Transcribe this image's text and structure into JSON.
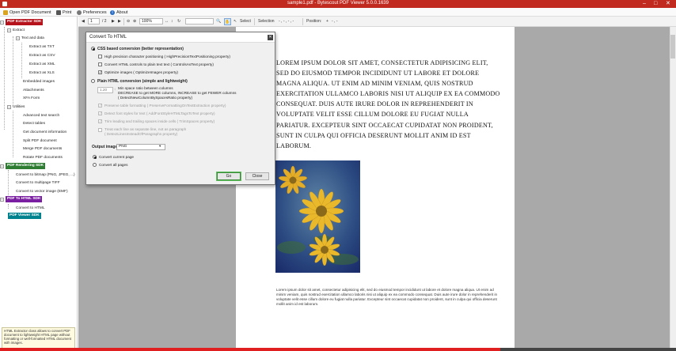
{
  "window": {
    "title": "sample1.pdf - Bytescout PDF Viewer 5.0.0.1639"
  },
  "menu": {
    "open_pdf": "Open PDF Document",
    "print": "Print",
    "preferences": "Preferences",
    "about": "About"
  },
  "tree": {
    "pdf_extractor_sdk": "PDF Extractor SDK",
    "extract": "Extract",
    "text_and_data": "Text and data",
    "extract_txt": "Extract as TXT",
    "extract_csv": "Extract as CSV",
    "extract_xml": "Extract as XML",
    "extract_xls": "Extract as XLS",
    "embedded_images": "Embedded images",
    "attachments": "Attachments",
    "xfa_form": "XFA Form",
    "utilities": "Utilities",
    "advanced_text_search": "Advanced text search",
    "detect_tables": "Detect tables",
    "get_document_information": "Get document information",
    "split_pdf": "Split PDF document",
    "merge_pdf": "Merge PDF documents",
    "rotate_pdf": "Rotate PDF documents",
    "pdf_rendering_sdk": "PDF Rendering SDK",
    "convert_bitmap": "Convert to bitmap (PNG, JPEG, ...)",
    "convert_tiff": "Convert to multipage TIFF",
    "convert_vector": "Convert to vector image (EMF)",
    "pdf_to_html_sdk": "PDF To HTML SDK",
    "convert_html": "Convert to HTML",
    "pdf_viewer_sdk": "PDF Viewer SDK"
  },
  "info_text": "HTML Extractor class allows to convert PDF document to lightweight HTML page without formatting or well-formatted HTML document with images.",
  "toolbar": {
    "page_current": "1",
    "page_total": "/ 2",
    "zoom": "100%",
    "select": "Select",
    "selection": "Selection",
    "selection_value": "- , - , - , -",
    "position": "Position:",
    "position_value": "- , -"
  },
  "document": {
    "heading_text": "Lorem ipsum dolor sit amet, consectetur adipisicing elit, sed do eiusmod tempor incididunt ut labore et dolore magna aliqua. Ut enim ad minim veniam, quis nostrud exercitation ullamco laboris nisi ut aliquip ex ea commodo consequat. Duis aute irure dolor in reprehenderit in voluptate velit esse cillum dolore eu fugiat nulla pariatur. Excepteur sint occaecat cupidatat non proident, sunt in culpa qui officia deserunt mollit anim id est laborum.",
    "body_text": "Lorem ipsum dolor sit amet, consectetur adipisicing elit, sed do eiusmod tempor incididunt ut labore et dolore magna aliqua. Ut enim ad minim veniam, quis nostrud exercitation ullamco laboris nisi ut aliquip ex ea commodo consequat. Duis aute irure dolor in reprehenderit in voluptate velit esse cillum dolore eu fugiat nulla pariatur. Excepteur sint occaecat cupidatat non proident, sunt in culpa qui officia deserunt mollit anim id est laborum."
  },
  "dialog": {
    "title": "Convert To HTML",
    "css_based": "CSS based conversion (better representation)",
    "high_precision": "High precision character positioning ( HighPrecisionTextPositioning property)",
    "convert_controls": "Convert HTML controls to plain text text ( ControlsAsText property)",
    "optimize_images": "Optimize images ( OptimizeImages property)",
    "plain_html": "Plain HTML conversion (simple and lightweight)",
    "min_space_value": "1.20",
    "min_space_line1": "Min space ratio between columns",
    "min_space_line2": "DECREASE to get MORE columns, INCREASE to get FEWER columns",
    "min_space_line3": "( DetectNewColumnBySpacesRatio property)",
    "preserve_formatting": "Preserve table formatting ( PreserveFormattingOnTextExtraction property)",
    "detect_font_styles": "Detect font styles for text ( AddFontStyleHTMLTagsToText property)",
    "trim_spaces": "Trim leading and trailing spaces inside cells ( TrimSpaces property)",
    "treat_lines": "Treat each line as separate line, not as paragraph",
    "treat_lines2": "( DetectLinesInsteadOfParagraphs property)",
    "output_format_label": "Output images format",
    "output_format_value": "PNG",
    "convert_current": "Convert current page",
    "convert_all": "Convert all pages",
    "go": "Go",
    "close": "Close"
  },
  "progress": 0.74,
  "colors": {
    "title_bar": "#c12a1f",
    "extractor_sdk": "#b5121b",
    "rendering_sdk": "#2e7d32",
    "html_sdk": "#7b1fa2",
    "viewer_sdk": "#00838f"
  }
}
